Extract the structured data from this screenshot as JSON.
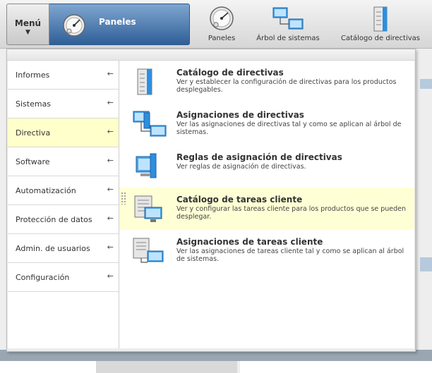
{
  "topbar": {
    "menu_label": "Menú",
    "menu_arrow": "▼",
    "active_title": "Paneles",
    "shortcuts": [
      {
        "label": "Paneles",
        "icon": "gauge-icon"
      },
      {
        "label": "Árbol de sistemas",
        "icon": "system-tree-icon"
      },
      {
        "label": "Catálogo de directivas",
        "icon": "policy-catalog-icon"
      }
    ]
  },
  "left_menu": {
    "items": [
      {
        "label": "Informes",
        "arrow": "←"
      },
      {
        "label": "Sistemas",
        "arrow": "←"
      },
      {
        "label": "Directiva",
        "arrow": "←",
        "selected": true
      },
      {
        "label": "Software",
        "arrow": "←"
      },
      {
        "label": "Automatización",
        "arrow": "←"
      },
      {
        "label": "Protección de datos",
        "arrow": "←"
      },
      {
        "label": "Admin. de usuarios",
        "arrow": "←"
      },
      {
        "label": "Configuración",
        "arrow": "←"
      }
    ]
  },
  "submenu": {
    "entries": [
      {
        "title": "Catálogo de directivas",
        "desc": "Ver y establecer la configuración de directivas para los productos desplegables.",
        "icon": "policy-catalog-icon"
      },
      {
        "title": "Asignaciones de directivas",
        "desc": "Ver las asignaciones de directivas tal y como se aplican al árbol de sistemas.",
        "icon": "policy-assignment-icon"
      },
      {
        "title": "Reglas de asignación de directivas",
        "desc": "Ver reglas de asignación de directivas.",
        "icon": "policy-rule-icon"
      },
      {
        "title": "Catálogo de tareas cliente",
        "desc": "Ver y configurar las tareas cliente para los productos que se pueden desplegar.",
        "icon": "client-task-catalog-icon"
      },
      {
        "title": "Asignaciones de tareas cliente",
        "desc": "Ver las asignaciones de tareas cliente tal y como se aplican al árbol de sistemas.",
        "icon": "client-task-assignment-icon"
      }
    ]
  },
  "colors": {
    "accent": "#2f5f98",
    "selected_row": "#ffffcc",
    "highlight_row": "#ffffd6"
  }
}
